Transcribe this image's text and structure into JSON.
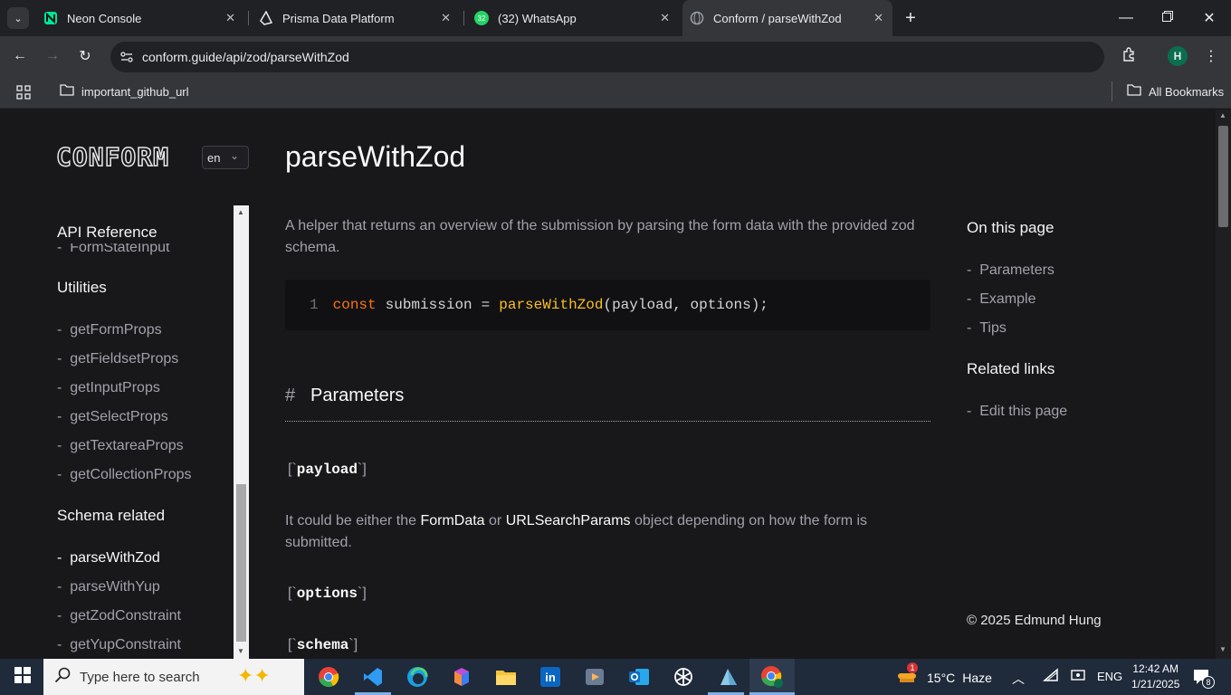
{
  "browser": {
    "tabs": [
      {
        "title": "Neon Console",
        "icon": "neon-logo-icon"
      },
      {
        "title": "Prisma Data Platform",
        "icon": "prisma-logo-icon"
      },
      {
        "title": "(32) WhatsApp",
        "icon": "whatsapp-icon",
        "badge": "32"
      },
      {
        "title": "Conform / parseWithZod",
        "icon": "globe-icon",
        "active": true
      }
    ],
    "url": "conform.guide/api/zod/parseWithZod",
    "profile_initial": "H",
    "bookmarks": {
      "folder": "important_github_url",
      "all": "All Bookmarks"
    }
  },
  "site": {
    "logo": "CONFORM",
    "language": "en"
  },
  "sidebar": {
    "api_reference": "API Reference",
    "cut_item": "FormStateInput",
    "utilities_heading": "Utilities",
    "utilities": [
      "getFormProps",
      "getFieldsetProps",
      "getInputProps",
      "getSelectProps",
      "getTextareaProps",
      "getCollectionProps"
    ],
    "schema_heading": "Schema related",
    "schema": [
      "parseWithZod",
      "parseWithYup",
      "getZodConstraint",
      "getYupConstraint"
    ],
    "active": "parseWithZod",
    "dash": "-"
  },
  "main": {
    "title": "parseWithZod",
    "intro": "A helper that returns an overview of the submission by parsing the form data with the provided zod schema.",
    "code": {
      "line_no": "1",
      "kw": "const",
      "var": "submission",
      "eq": "=",
      "fn": "parseWithZod",
      "args": "(payload, options);"
    },
    "params_hash": "#",
    "params_heading": "Parameters",
    "payload_label": "payload",
    "payload_desc_1": "It could be either the ",
    "payload_desc_formdata": "FormData",
    "payload_desc_or": " or ",
    "payload_desc_usp": "URLSearchParams",
    "payload_desc_2": " object depending on how the form is submitted.",
    "options_label": "options",
    "schema_label": "schema",
    "bracket_open": "[`",
    "bracket_close": "`]"
  },
  "toc": {
    "heading": "On this page",
    "items": [
      "Parameters",
      "Example",
      "Tips"
    ],
    "related_heading": "Related links",
    "related": [
      "Edit this page"
    ],
    "copyright": "© 2025 Edmund Hung"
  },
  "taskbar": {
    "search_placeholder": "Type here to search",
    "weather": "15°C",
    "weather_desc": "Haze",
    "weather_badge": "1",
    "language": "ENG",
    "time": "12:42 AM",
    "date": "1/21/2025",
    "notif_count": "8",
    "apps": [
      "chrome-icon",
      "vscode-icon",
      "edge-icon",
      "copilot-icon",
      "file-explorer-icon",
      "linkedin-icon",
      "media-player-icon",
      "outlook-icon",
      "chatgpt-icon",
      "app-icon",
      "chrome-profile-icon"
    ]
  },
  "colors": {
    "accent_keyword": "#f97316",
    "function": "#fbbf24",
    "page_bg": "#18181b",
    "code_bg": "#111113"
  }
}
